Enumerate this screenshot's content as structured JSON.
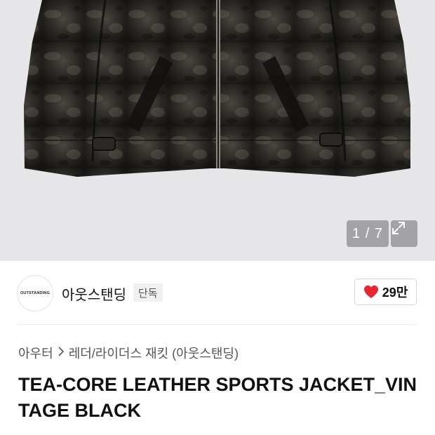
{
  "gallery": {
    "counter": "1 / 7"
  },
  "brand": {
    "logo_text": "OUTSTANDING",
    "name": "아웃스탠딩",
    "badge": "단독"
  },
  "like": {
    "count": "29만",
    "color": "#e8262f"
  },
  "breadcrumb": {
    "items": [
      "아우터",
      "레더/라이더스 재킷 (아웃스탠딩)"
    ]
  },
  "product": {
    "title": "TEA-CORE LEATHER SPORTS JACKET_VINTAGE BLACK"
  },
  "icons": {
    "expand": "expand-icon",
    "heart": "heart-icon",
    "chevron": "chevron-right-icon"
  }
}
